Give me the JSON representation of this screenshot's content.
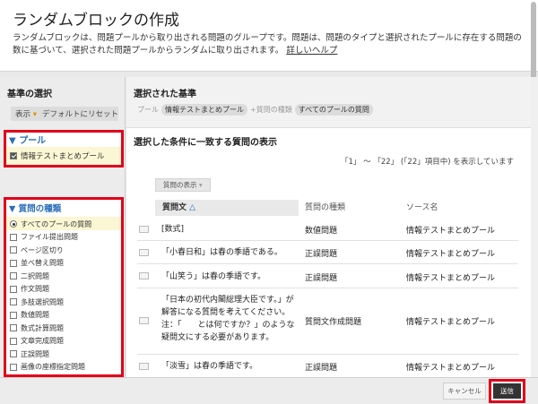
{
  "header": {
    "title": "ランダムブロックの作成",
    "description": "ランダムブロックは、問題プールから取り出される問題のグループです。問題は、問題のタイプと選択されたプールに存在する問題の数に基づいて、選択された問題プールからランダムに取り出されます。",
    "help_link": "詳しいヘルプ"
  },
  "left": {
    "heading": "基準の選択",
    "show_label": "表示",
    "reset_label": "デフォルトにリセット",
    "pool_heading": "プール",
    "pool_item": "情報テストまとめプール",
    "types_heading": "質問の種類",
    "types": [
      "すべてのプールの質問",
      "ファイル提出問題",
      "ページ区切り",
      "並べ替え問題",
      "二択問題",
      "作文問題",
      "多肢選択問題",
      "数値問題",
      "数式計算問題",
      "文章完成問題",
      "正誤問題",
      "画像の座標指定問題"
    ]
  },
  "criteria": {
    "heading": "選択された基準",
    "pool_label": "プール",
    "pool_value": "情報テストまとめプール",
    "type_label": "+質問の種類",
    "type_value": "すべてのプールの質問"
  },
  "main": {
    "heading": "選択した条件に一致する質問の表示",
    "range": "「1」 ～ 「22」 (「22」項目中) を表示しています",
    "show_button": "質問の表示",
    "col_question": "質問文",
    "col_type": "質問の種類",
    "col_source": "ソース名",
    "rows": [
      {
        "q": "[数式]",
        "type": "数値問題",
        "source": "情報テストまとめプール"
      },
      {
        "q": "「小春日和」は春の季語である。",
        "type": "正誤問題",
        "source": "情報テストまとめプール"
      },
      {
        "q": "「山笑う」は春の季語です。",
        "type": "正誤問題",
        "source": "情報テストまとめプール"
      },
      {
        "q": "「日本の初代内閣総理大臣です。」が解答になる質問を考えてください。注：「　　とは何ですか？」のような疑問文にする必要があります。",
        "type": "質問文作成問題",
        "source": "情報テストまとめプール"
      },
      {
        "q": "「淡雪」は春の季語です。",
        "type": "正誤問題",
        "source": "情報テストまとめプール"
      }
    ]
  },
  "footer": {
    "cancel": "キャンセル",
    "submit": "送信"
  }
}
